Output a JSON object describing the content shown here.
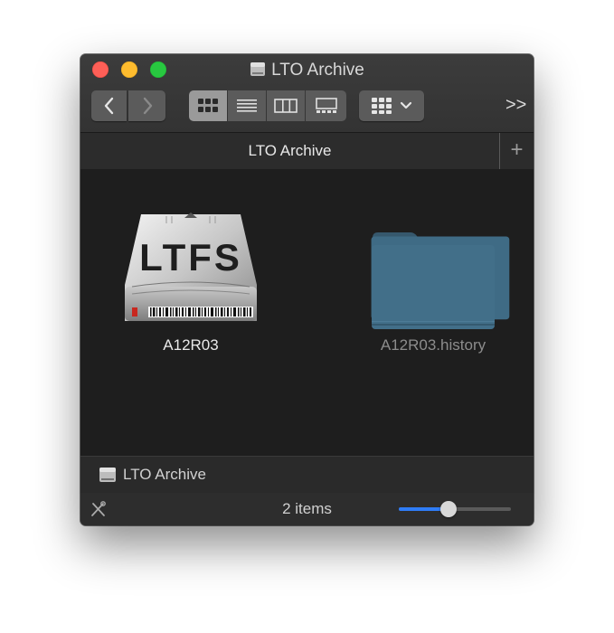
{
  "window": {
    "title": "LTO Archive",
    "title_icon": "disk-icon"
  },
  "toolbar": {
    "back_icon": "chevron-left-icon",
    "forward_icon": "chevron-right-icon",
    "view_modes": [
      {
        "name": "icon-view",
        "icon": "grid-icon",
        "selected": true
      },
      {
        "name": "list-view",
        "icon": "list-icon",
        "selected": false
      },
      {
        "name": "column-view",
        "icon": "columns-icon",
        "selected": false
      },
      {
        "name": "gallery-view",
        "icon": "gallery-icon",
        "selected": false
      }
    ],
    "group_icon": "group-grid-icon",
    "overflow_label": ">>"
  },
  "tabbar": {
    "tab_title": "LTO Archive",
    "add_tab_label": "+"
  },
  "items": [
    {
      "name": "A12R03",
      "icon": "ltfs-tape-icon",
      "icon_text": "LTFS",
      "dimmed": false
    },
    {
      "name": "A12R03.history",
      "icon": "folder-icon",
      "dimmed": true
    }
  ],
  "pathbar": {
    "label": "LTO Archive",
    "icon": "disk-icon"
  },
  "statusbar": {
    "item_count": "2 items",
    "tool_icon": "tools-icon",
    "icon_size_level": 0.44
  },
  "colors": {
    "close": "#fe5f57",
    "minimize": "#febc2e",
    "zoom": "#28c840",
    "slider_accent": "#2f7cf6",
    "folder": "#3f6b85"
  }
}
